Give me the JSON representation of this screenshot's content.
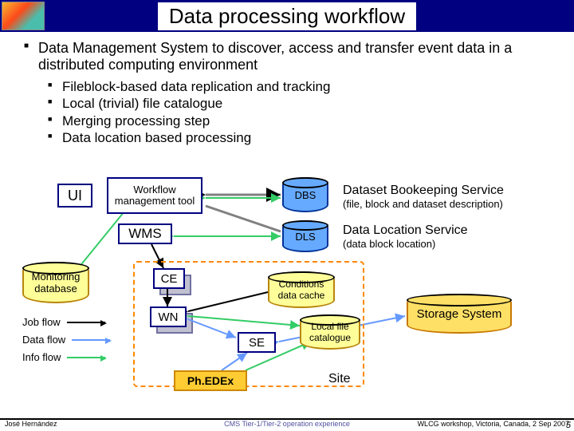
{
  "title": "Data processing workflow",
  "main_bullet": "Data Management System to discover, access and transfer event data in a distributed computing environment",
  "sub_bullets": [
    "Fileblock-based data replication and tracking",
    "Local (trivial) file catalogue",
    "Merging processing step",
    "Data location based processing"
  ],
  "nodes": {
    "ui": "UI",
    "wfm": "Workflow management tool",
    "wms": "WMS",
    "dbs": "DBS",
    "dls": "DLS",
    "ce": "CE",
    "wn": "WN",
    "se": "SE",
    "phedex": "Ph.EDEx",
    "mon_db": "Monitoring database",
    "cond_cache": "Conditions data cache",
    "lfc": "Local file catalogue",
    "storage": "Storage System",
    "site": "Site"
  },
  "desc": {
    "dbs_title": "Dataset Bookeeping Service",
    "dbs_sub": "(file, block and dataset description)",
    "dls_title": "Data Location Service",
    "dls_sub": "(data block location)"
  },
  "legend": {
    "job": "Job flow",
    "data": "Data flow",
    "info": "Info flow"
  },
  "footer": {
    "author": "José Hernández",
    "center": "CMS Tier-1/Tier-2 operation experience",
    "right": "WLCG workshop, Victoria, Canada, 2 Sep 2007",
    "page": "5"
  }
}
